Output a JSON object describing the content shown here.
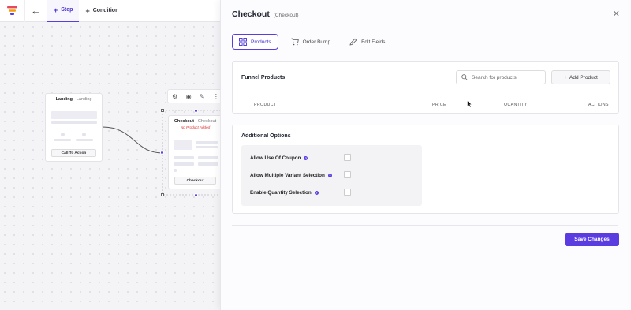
{
  "topbar": {
    "tabs": [
      {
        "label": "Step",
        "active": true
      },
      {
        "label": "Condition",
        "active": false
      }
    ]
  },
  "canvas": {
    "landing_node": {
      "title": "Landing",
      "subtitle": "Landing",
      "button": "Call To Action"
    },
    "checkout_node": {
      "title": "Checkout",
      "subtitle": "Checkout",
      "warning": "No Product Added",
      "button": "Checkout"
    },
    "toolbar_icons": [
      "gear-icon",
      "eye-icon",
      "pencil-icon",
      "more-vertical-icon"
    ]
  },
  "panel": {
    "title": "Checkout",
    "subtitle": "(Checkout)",
    "tabs": [
      {
        "label": "Products",
        "icon": "grid-icon",
        "active": true
      },
      {
        "label": "Order Bump",
        "icon": "cart-icon",
        "active": false
      },
      {
        "label": "Edit Fields",
        "icon": "edit-icon",
        "active": false
      }
    ],
    "products": {
      "title": "Funnel Products",
      "search_placeholder": "Search for products",
      "add_label": "Add Product",
      "columns": [
        "PRODUCT",
        "PRICE",
        "QUANTITY",
        "ACTIONS"
      ]
    },
    "options": {
      "title": "Additional Options",
      "items": [
        {
          "label": "Allow Use Of Coupon",
          "checked": false
        },
        {
          "label": "Allow Multiple Variant Selection",
          "checked": false
        },
        {
          "label": "Enable Quantity Selection",
          "checked": false
        }
      ]
    },
    "save_label": "Save Changes"
  },
  "colors": {
    "accent": "#5b3ce0",
    "warning": "#e03131"
  }
}
